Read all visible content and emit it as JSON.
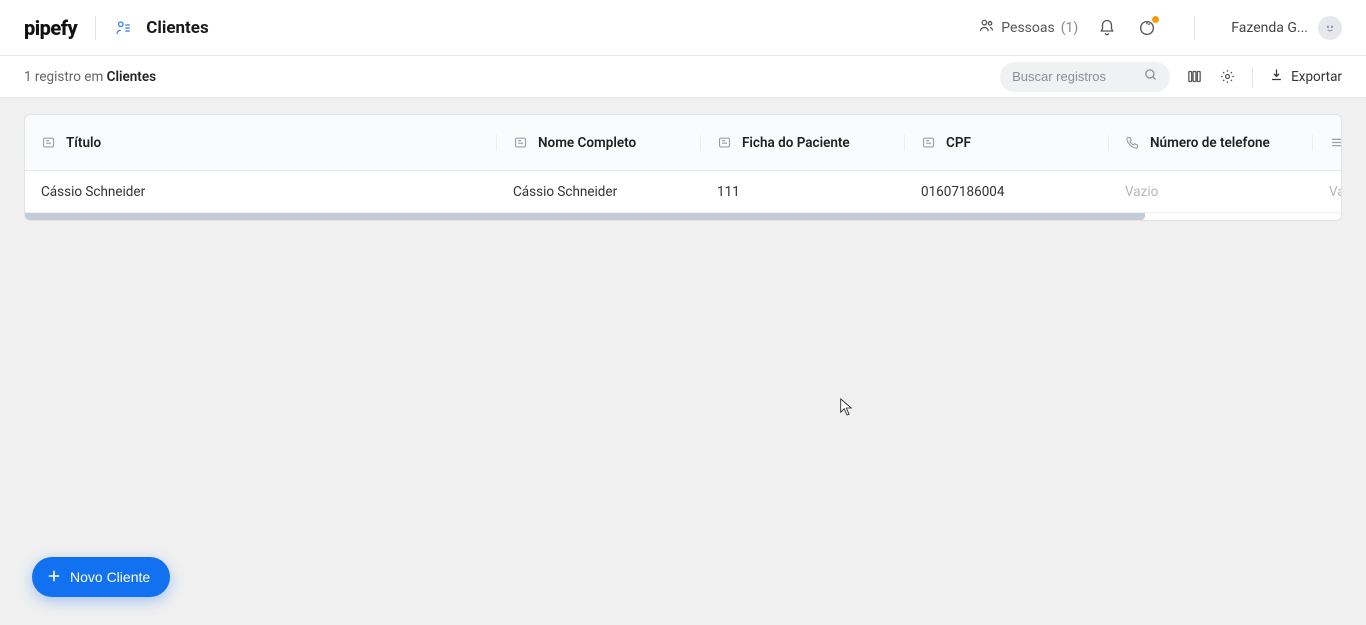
{
  "header": {
    "logo_text": "pipefy",
    "page_title": "Clientes",
    "people_label": "Pessoas",
    "people_count": "(1)",
    "org_name": "Fazenda G..."
  },
  "toolbar": {
    "count_prefix": "1 registro em ",
    "count_entity": "Clientes",
    "search_placeholder": "Buscar registros",
    "export_label": "Exportar"
  },
  "table": {
    "columns": [
      {
        "label": "Título",
        "icon": "text"
      },
      {
        "label": "Nome Completo",
        "icon": "text"
      },
      {
        "label": "Ficha do Paciente",
        "icon": "text"
      },
      {
        "label": "CPF",
        "icon": "text"
      },
      {
        "label": "Número de telefone",
        "icon": "phone"
      }
    ],
    "rows": [
      {
        "titulo": "Cássio Schneider",
        "nome": "Cássio Schneider",
        "ficha": "111",
        "cpf": "01607186004",
        "telefone": "Vazio",
        "extra": "Vaz"
      }
    ]
  },
  "fab": {
    "label": "Novo Cliente"
  }
}
